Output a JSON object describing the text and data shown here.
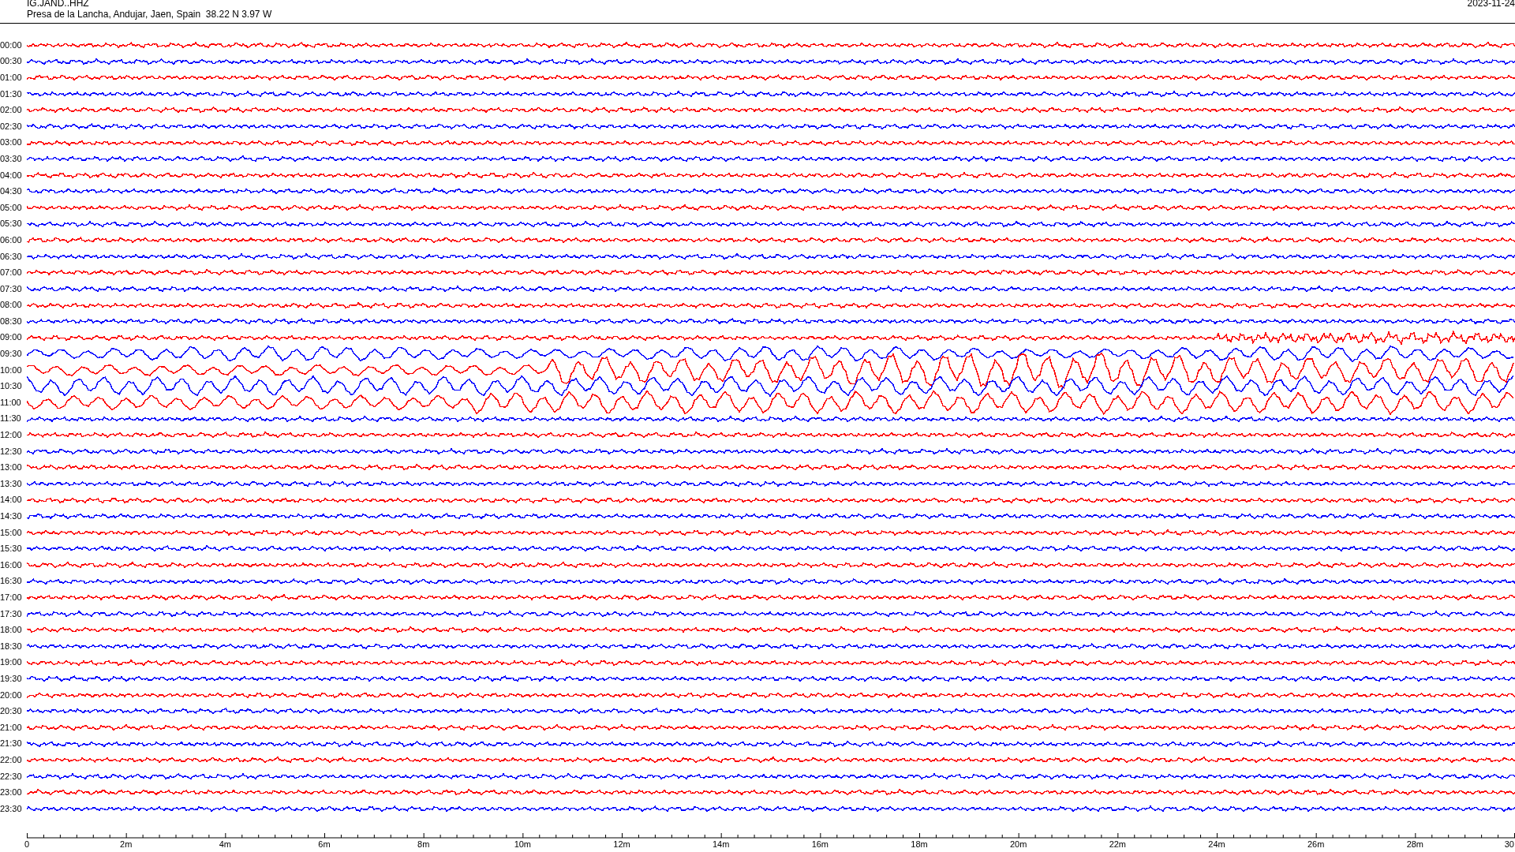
{
  "header": {
    "station": "IG.JAND..HHZ",
    "location": "Presa de la Lancha, Andujar, Jaen, Spain  38.22 N 3.97 W",
    "date": "2023-11-24"
  },
  "rows": [
    {
      "label": "00:00",
      "color": "#ff0000"
    },
    {
      "label": "00:30",
      "color": "#0000ff"
    },
    {
      "label": "01:00",
      "color": "#ff0000"
    },
    {
      "label": "01:30",
      "color": "#0000ff"
    },
    {
      "label": "02:00",
      "color": "#ff0000"
    },
    {
      "label": "02:30",
      "color": "#0000ff"
    },
    {
      "label": "03:00",
      "color": "#ff0000"
    },
    {
      "label": "03:30",
      "color": "#0000ff"
    },
    {
      "label": "04:00",
      "color": "#ff0000"
    },
    {
      "label": "04:30",
      "color": "#0000ff"
    },
    {
      "label": "05:00",
      "color": "#ff0000"
    },
    {
      "label": "05:30",
      "color": "#0000ff"
    },
    {
      "label": "06:00",
      "color": "#ff0000"
    },
    {
      "label": "06:30",
      "color": "#0000ff"
    },
    {
      "label": "07:00",
      "color": "#ff0000"
    },
    {
      "label": "07:30",
      "color": "#0000ff"
    },
    {
      "label": "08:00",
      "color": "#ff0000"
    },
    {
      "label": "08:30",
      "color": "#0000ff"
    },
    {
      "label": "09:00",
      "color": "#ff0000"
    },
    {
      "label": "09:30",
      "color": "#0000ff"
    },
    {
      "label": "10:00",
      "color": "#ff0000"
    },
    {
      "label": "10:30",
      "color": "#0000ff"
    },
    {
      "label": "11:00",
      "color": "#ff0000"
    },
    {
      "label": "11:30",
      "color": "#0000ff"
    },
    {
      "label": "12:00",
      "color": "#ff0000"
    },
    {
      "label": "12:30",
      "color": "#0000ff"
    },
    {
      "label": "13:00",
      "color": "#ff0000"
    },
    {
      "label": "13:30",
      "color": "#0000ff"
    },
    {
      "label": "14:00",
      "color": "#ff0000"
    },
    {
      "label": "14:30",
      "color": "#0000ff"
    },
    {
      "label": "15:00",
      "color": "#ff0000"
    },
    {
      "label": "15:30",
      "color": "#0000ff"
    },
    {
      "label": "16:00",
      "color": "#ff0000"
    },
    {
      "label": "16:30",
      "color": "#0000ff"
    },
    {
      "label": "17:00",
      "color": "#ff0000"
    },
    {
      "label": "17:30",
      "color": "#0000ff"
    },
    {
      "label": "18:00",
      "color": "#ff0000"
    },
    {
      "label": "18:30",
      "color": "#0000ff"
    },
    {
      "label": "19:00",
      "color": "#ff0000"
    },
    {
      "label": "19:30",
      "color": "#0000ff"
    },
    {
      "label": "20:00",
      "color": "#ff0000"
    },
    {
      "label": "20:30",
      "color": "#0000ff"
    },
    {
      "label": "21:00",
      "color": "#ff0000"
    },
    {
      "label": "21:30",
      "color": "#0000ff"
    },
    {
      "label": "22:00",
      "color": "#ff0000"
    },
    {
      "label": "22:30",
      "color": "#0000ff"
    },
    {
      "label": "23:00",
      "color": "#ff0000"
    },
    {
      "label": "23:30",
      "color": "#0000ff"
    }
  ],
  "x_axis": {
    "labels": [
      "0",
      "2m",
      "4m",
      "6m",
      "8m",
      "10m",
      "12m",
      "14m",
      "16m",
      "18m",
      "20m",
      "22m",
      "24m",
      "26m",
      "28m",
      "30"
    ]
  }
}
